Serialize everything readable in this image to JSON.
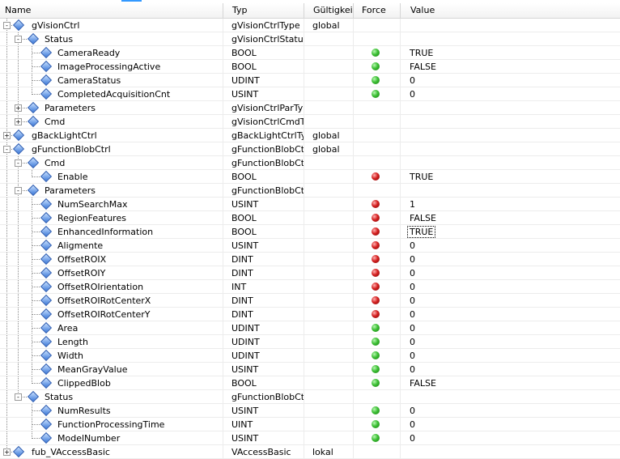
{
  "columns": {
    "name": "Name",
    "type": "Typ",
    "scope": "Gültigkeits",
    "force": "Force",
    "value": "Value"
  },
  "rows": [
    {
      "name": "gVisionCtrl",
      "type": "gVisionCtrlType",
      "scope": "global",
      "value": "",
      "led": "",
      "level": 0,
      "expander": "-"
    },
    {
      "name": "Status",
      "type": "gVisionCtrlStatus",
      "scope": "",
      "value": "",
      "led": "",
      "level": 1,
      "expander": "-"
    },
    {
      "name": "CameraReady",
      "type": "BOOL",
      "scope": "",
      "value": "TRUE",
      "led": "green",
      "level": 2
    },
    {
      "name": "ImageProcessingActive",
      "type": "BOOL",
      "scope": "",
      "value": "FALSE",
      "led": "green",
      "level": 2
    },
    {
      "name": "CameraStatus",
      "type": "UDINT",
      "scope": "",
      "value": "0",
      "led": "green",
      "level": 2
    },
    {
      "name": "CompletedAcquisitionCnt",
      "type": "USINT",
      "scope": "",
      "value": "0",
      "led": "green",
      "level": 2
    },
    {
      "name": "Parameters",
      "type": "gVisionCtrlParTy",
      "scope": "",
      "value": "",
      "led": "",
      "level": 1,
      "expander": "+"
    },
    {
      "name": "Cmd",
      "type": "gVisionCtrlCmdT",
      "scope": "",
      "value": "",
      "led": "",
      "level": 1,
      "expander": "+"
    },
    {
      "name": "gBackLightCtrl",
      "type": "gBackLightCtrlTy",
      "scope": "global",
      "value": "",
      "led": "",
      "level": 0,
      "expander": "+"
    },
    {
      "name": "gFunctionBlobCtrl",
      "type": "gFunctionBlobCt",
      "scope": "global",
      "value": "",
      "led": "",
      "level": 0,
      "expander": "-"
    },
    {
      "name": "Cmd",
      "type": "gFunctionBlobCt",
      "scope": "",
      "value": "",
      "led": "",
      "level": 1,
      "expander": "-"
    },
    {
      "name": "Enable",
      "type": "BOOL",
      "scope": "",
      "value": "TRUE",
      "led": "red",
      "level": 2
    },
    {
      "name": "Parameters",
      "type": "gFunctionBlobCt",
      "scope": "",
      "value": "",
      "led": "",
      "level": 1,
      "expander": "-"
    },
    {
      "name": "NumSearchMax",
      "type": "USINT",
      "scope": "",
      "value": "1",
      "led": "red",
      "level": 2
    },
    {
      "name": "RegionFeatures",
      "type": "BOOL",
      "scope": "",
      "value": "FALSE",
      "led": "red",
      "level": 2
    },
    {
      "name": "EnhancedInformation",
      "type": "BOOL",
      "scope": "",
      "value": "TRUE",
      "led": "red",
      "level": 2,
      "focused": true
    },
    {
      "name": "Aligmente",
      "type": "USINT",
      "scope": "",
      "value": "0",
      "led": "red",
      "level": 2
    },
    {
      "name": "OffsetROIX",
      "type": "DINT",
      "scope": "",
      "value": "0",
      "led": "red",
      "level": 2
    },
    {
      "name": "OffsetROIY",
      "type": "DINT",
      "scope": "",
      "value": "0",
      "led": "red",
      "level": 2
    },
    {
      "name": "OffsetROIrientation",
      "type": "INT",
      "scope": "",
      "value": "0",
      "led": "red",
      "level": 2
    },
    {
      "name": "OffsetROIRotCenterX",
      "type": "DINT",
      "scope": "",
      "value": "0",
      "led": "red",
      "level": 2
    },
    {
      "name": "OffsetROIRotCenterY",
      "type": "DINT",
      "scope": "",
      "value": "0",
      "led": "red",
      "level": 2
    },
    {
      "name": "Area",
      "type": "UDINT",
      "scope": "",
      "value": "0",
      "led": "green",
      "level": 2
    },
    {
      "name": "Length",
      "type": "UDINT",
      "scope": "",
      "value": "0",
      "led": "green",
      "level": 2
    },
    {
      "name": "Width",
      "type": "UDINT",
      "scope": "",
      "value": "0",
      "led": "green",
      "level": 2
    },
    {
      "name": "MeanGrayValue",
      "type": "USINT",
      "scope": "",
      "value": "0",
      "led": "green",
      "level": 2
    },
    {
      "name": "ClippedBlob",
      "type": "BOOL",
      "scope": "",
      "value": "FALSE",
      "led": "green",
      "level": 2
    },
    {
      "name": "Status",
      "type": "gFunctionBlobCt",
      "scope": "",
      "value": "",
      "led": "",
      "level": 1,
      "expander": "-"
    },
    {
      "name": "NumResults",
      "type": "USINT",
      "scope": "",
      "value": "0",
      "led": "green",
      "level": 2
    },
    {
      "name": "FunctionProcessingTime",
      "type": "UINT",
      "scope": "",
      "value": "0",
      "led": "green",
      "level": 2
    },
    {
      "name": "ModelNumber",
      "type": "USINT",
      "scope": "",
      "value": "0",
      "led": "green",
      "level": 2
    },
    {
      "name": "fub_VAccessBasic",
      "type": "VAccessBasic",
      "scope": "lokal",
      "value": "",
      "led": "",
      "level": 0,
      "expander": "+"
    }
  ]
}
